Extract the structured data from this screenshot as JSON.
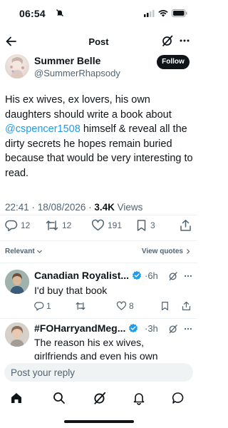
{
  "status_bar": {
    "time": "06:54"
  },
  "nav": {
    "title": "Post"
  },
  "author": {
    "name": "Summer Belle",
    "handle": "@SummerRhapsody",
    "follow_label": "Follow"
  },
  "tweet": {
    "text_1": "His ex wives, ex lovers, his own daughters should write a book about ",
    "mention": "@cspencer1508",
    "text_2": " himself & reveal all the dirty secrets he hopes remain buried because that would be very interesting to read.",
    "timestamp": "22:41 · 18/08/2026 · ",
    "views_count": "3.4K",
    "views_label": " Views"
  },
  "actions": {
    "replies": "12",
    "reposts": "12",
    "likes": "191",
    "bookmarks": "3"
  },
  "sort": {
    "relevant_label": "Relevant",
    "view_quotes_label": "View quotes"
  },
  "replies": [
    {
      "name": "Canadian Royalist...",
      "time": "·6h",
      "text": "I'd buy that book",
      "replies": "1",
      "likes": "8"
    },
    {
      "name": "#FOHarryandMeg...",
      "time": "·3h",
      "text": "The reason his ex wives, girlfriends and even his own"
    }
  ],
  "reply_box": {
    "placeholder": "Post your reply"
  },
  "colors": {
    "accent": "#1d9bf0",
    "text": "#0f1419",
    "secondary": "#536471",
    "divider": "#eff3f4"
  },
  "icons": [
    "back-arrow-icon",
    "grok-icon",
    "more-icon",
    "verified-icon",
    "reply-icon",
    "repost-icon",
    "like-icon",
    "bookmark-icon",
    "share-icon",
    "home-icon",
    "search-icon",
    "notifications-icon",
    "messages-icon"
  ]
}
